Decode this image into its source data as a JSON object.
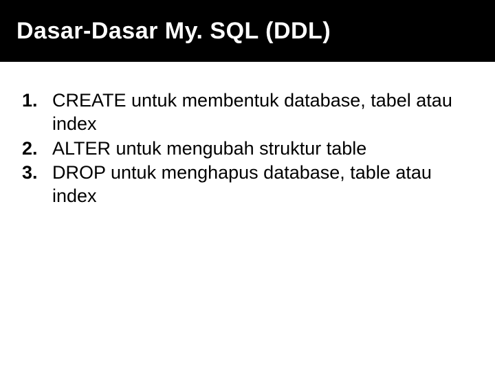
{
  "slide": {
    "title": "Dasar-Dasar My. SQL (DDL)",
    "items": [
      "CREATE untuk membentuk database, tabel atau index",
      "ALTER untuk mengubah struktur table",
      "DROP untuk menghapus database, table atau index"
    ]
  }
}
